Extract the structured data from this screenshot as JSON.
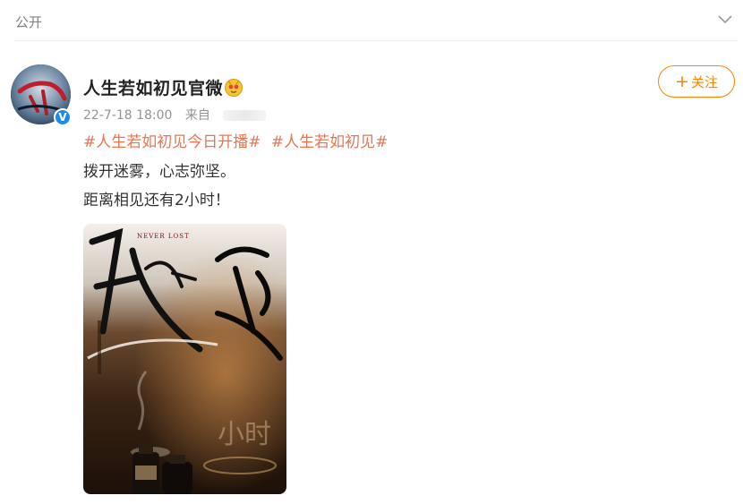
{
  "header": {
    "visibility_label": "公开",
    "dropdown_icon": "chevron-down-icon"
  },
  "post": {
    "author_name": "人生若如初见官微",
    "verified_badge": "V",
    "timestamp": "22-7-18 18:00",
    "source_label": "来自",
    "follow_label": "关注",
    "follow_plus": "+",
    "hashtags": [
      "#人生若如初见今日开播#",
      "#人生若如初见#"
    ],
    "text_lines": [
      "拨开迷雾，心志弥坚。",
      "距离相见还有2小时！"
    ]
  },
  "poster": {
    "subtitle": "NEVER LOST",
    "countdown_text": "小时"
  },
  "colors": {
    "accent_orange": "#ff8200",
    "hashtag": "#eb7350",
    "verified_blue": "#1a8cf0",
    "meta_gray": "#939393"
  }
}
